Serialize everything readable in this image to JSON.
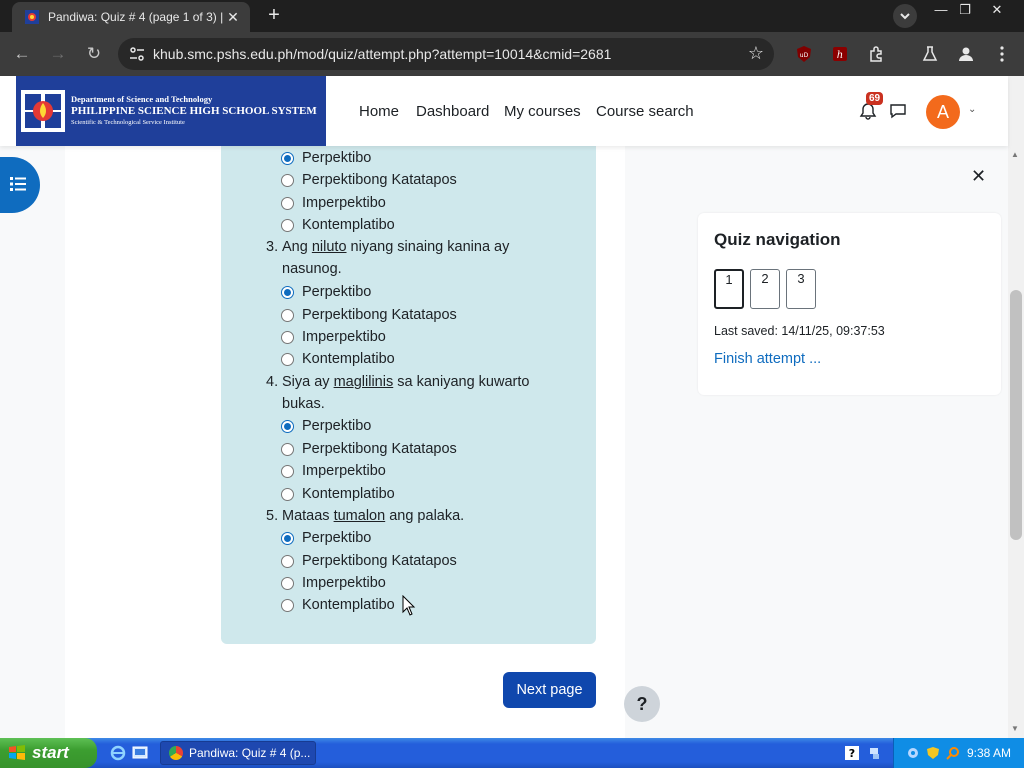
{
  "browser": {
    "tab_title": "Pandiwa: Quiz # 4 (page 1 of 3) |",
    "url": "khub.smc.pshs.edu.ph/mod/quiz/attempt.php?attempt=10014&cmid=2681"
  },
  "site": {
    "logo_line1": "Department of Science and Technology",
    "logo_line2": "PHILIPPINE SCIENCE HIGH SCHOOL SYSTEM",
    "logo_line3": "Scientific & Technological Service Institute",
    "menu": [
      "Home",
      "Dashboard",
      "My courses",
      "Course search"
    ],
    "notification_count": "69",
    "avatar_initial": "A"
  },
  "quiz": {
    "first_options": [
      {
        "label": "Perpektibo",
        "checked": true
      },
      {
        "label": "Perpektibong Katatapos",
        "checked": false
      },
      {
        "label": "Imperpektibo",
        "checked": false
      },
      {
        "label": "Kontemplatibo",
        "checked": false
      }
    ],
    "questions": [
      {
        "number": "3.",
        "before": "Ang ",
        "underlined": "niluto",
        "after": " niyang sinaing kanina ay",
        "line2": "nasunog.",
        "options": [
          {
            "label": "Perpektibo",
            "checked": true
          },
          {
            "label": "Perpektibong Katatapos",
            "checked": false
          },
          {
            "label": "Imperpektibo",
            "checked": false
          },
          {
            "label": "Kontemplatibo",
            "checked": false
          }
        ]
      },
      {
        "number": "4.",
        "before": "Siya ay ",
        "underlined": "maglilinis",
        "after": " sa kaniyang kuwarto",
        "line2": "bukas.",
        "options": [
          {
            "label": "Perpektibo",
            "checked": true
          },
          {
            "label": "Perpektibong Katatapos",
            "checked": false
          },
          {
            "label": "Imperpektibo",
            "checked": false
          },
          {
            "label": "Kontemplatibo",
            "checked": false
          }
        ]
      },
      {
        "number": "5.",
        "before": "Mataas ",
        "underlined": "tumalon",
        "after": " ang palaka.",
        "line2": "",
        "options": [
          {
            "label": "Perpektibo",
            "checked": true
          },
          {
            "label": "Perpektibong Katatapos",
            "checked": false
          },
          {
            "label": "Imperpektibo",
            "checked": false
          },
          {
            "label": "Kontemplatibo",
            "checked": false
          }
        ]
      }
    ],
    "next_label": "Next page",
    "help_label": "?"
  },
  "quiz_nav": {
    "title": "Quiz navigation",
    "pages": [
      "1",
      "2",
      "3"
    ],
    "current_page": "1",
    "last_saved": "Last saved: 14/11/25, 09:37:53",
    "finish_label": "Finish attempt ..."
  },
  "taskbar": {
    "start_label": "start",
    "task_label": "Pandiwa: Quiz # 4 (p...",
    "clock": "9:38 AM"
  },
  "colors": {
    "moodle_primary": "#0f6cbf",
    "formulation_bg": "#cfe8ec",
    "logo_bg": "#1f3f9a",
    "avatar_bg": "#f36a1c",
    "badge": "#ca3120"
  }
}
